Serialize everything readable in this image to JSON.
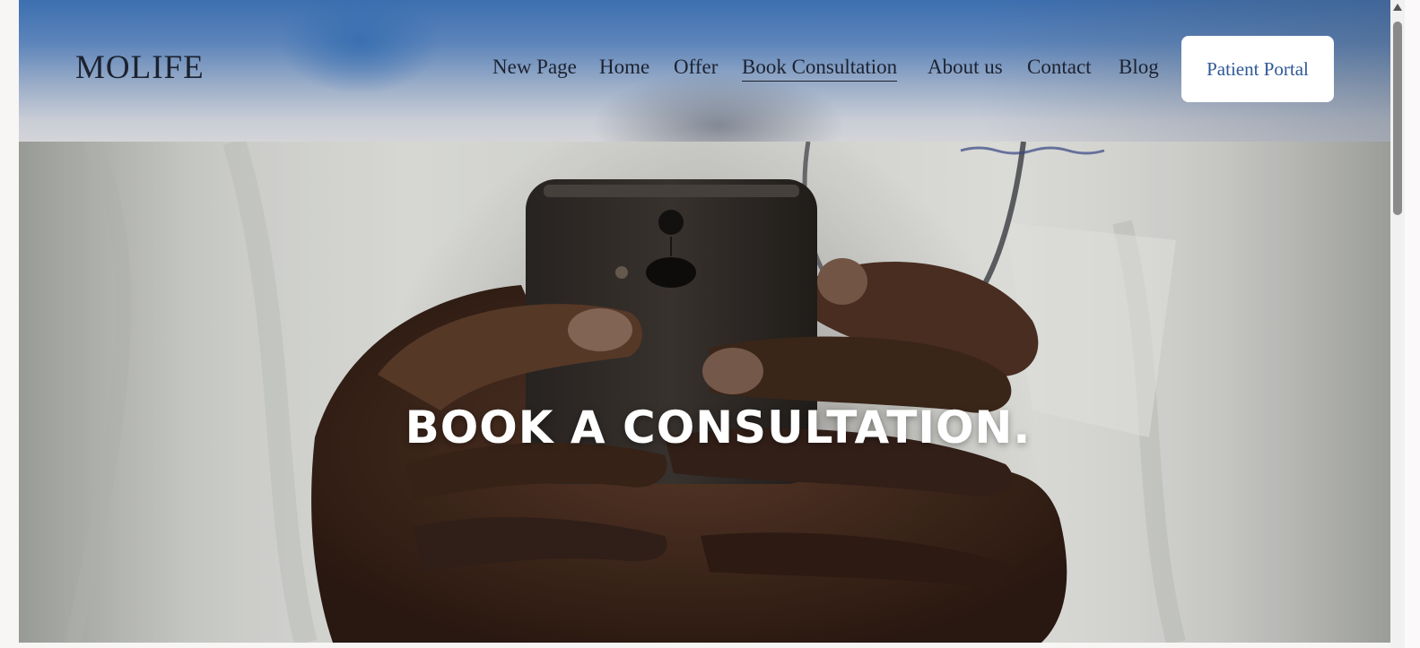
{
  "site": {
    "logo": "MOLIFE"
  },
  "nav": {
    "items": [
      {
        "label": "New Page"
      },
      {
        "label": "Home"
      },
      {
        "label": "Offer"
      },
      {
        "label": "Book Consultation",
        "active": true
      },
      {
        "label": "About us"
      },
      {
        "label": "Contact"
      },
      {
        "label": "Blog"
      }
    ],
    "portal_button": "Patient Portal"
  },
  "hero": {
    "title": "BOOK A CONSULTATION.",
    "image": "doctor-holding-smartphone"
  },
  "colors": {
    "header_top": "#3d6fb0",
    "portal_text": "#2f5896",
    "nav_text": "#1c2230",
    "hero_title": "#ffffff"
  }
}
